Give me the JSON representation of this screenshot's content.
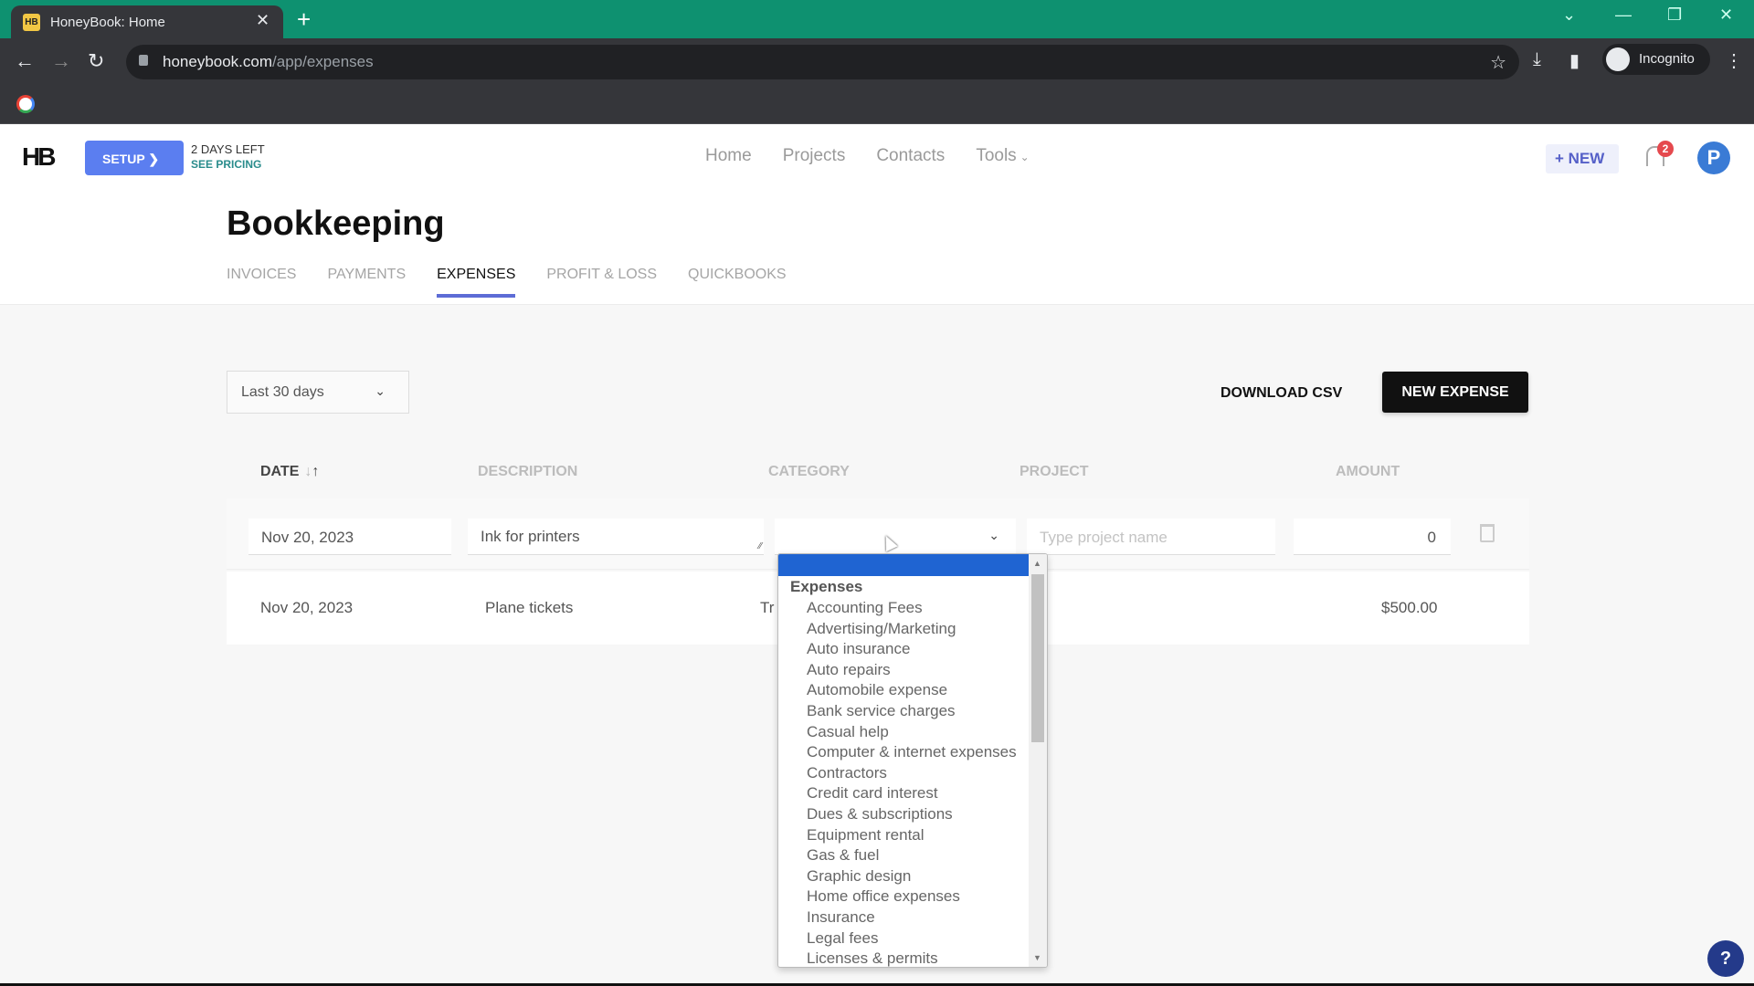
{
  "browser": {
    "tab_title": "HoneyBook: Home",
    "tab_favicon": "HB",
    "url_host": "honeybook.com",
    "url_path": "/app/expenses",
    "profile_label": "Incognito",
    "colors": {
      "tabbar": "#0e9170",
      "toolbar": "#35363a"
    }
  },
  "header": {
    "logo": "HB",
    "setup_label": "SETUP",
    "trial_days": "2 DAYS LEFT",
    "see_pricing": "SEE PRICING",
    "nav": [
      "Home",
      "Projects",
      "Contacts",
      "Tools"
    ],
    "new_label": "NEW",
    "notifications_count": "2",
    "avatar_initial": "P"
  },
  "page": {
    "title": "Bookkeeping",
    "tabs": [
      {
        "label": "INVOICES",
        "active": false
      },
      {
        "label": "PAYMENTS",
        "active": false
      },
      {
        "label": "EXPENSES",
        "active": true
      },
      {
        "label": "PROFIT & LOSS",
        "active": false
      },
      {
        "label": "QUICKBOOKS",
        "active": false
      }
    ]
  },
  "controls": {
    "range_value": "Last 30 days",
    "download_csv": "DOWNLOAD CSV",
    "new_expense": "NEW EXPENSE"
  },
  "table": {
    "columns": [
      "DATE",
      "DESCRIPTION",
      "CATEGORY",
      "PROJECT",
      "AMOUNT"
    ],
    "edit_row": {
      "date": "Nov 20, 2023",
      "description": "Ink for printers",
      "category": "",
      "project_placeholder": "Type project name",
      "amount": "0"
    },
    "rows": [
      {
        "date": "Nov 20, 2023",
        "description": "Plane tickets",
        "category": "Tr",
        "project": "",
        "amount": "$500.00"
      }
    ]
  },
  "category_dropdown": {
    "group": "Expenses",
    "options": [
      "Accounting Fees",
      "Advertising/Marketing",
      "Auto insurance",
      "Auto repairs",
      "Automobile expense",
      "Bank service charges",
      "Casual help",
      "Computer & internet expenses",
      "Contractors",
      "Credit card interest",
      "Dues & subscriptions",
      "Equipment rental",
      "Gas & fuel",
      "Graphic design",
      "Home office expenses",
      "Insurance",
      "Legal fees",
      "Licenses & permits"
    ]
  },
  "help_label": "?"
}
